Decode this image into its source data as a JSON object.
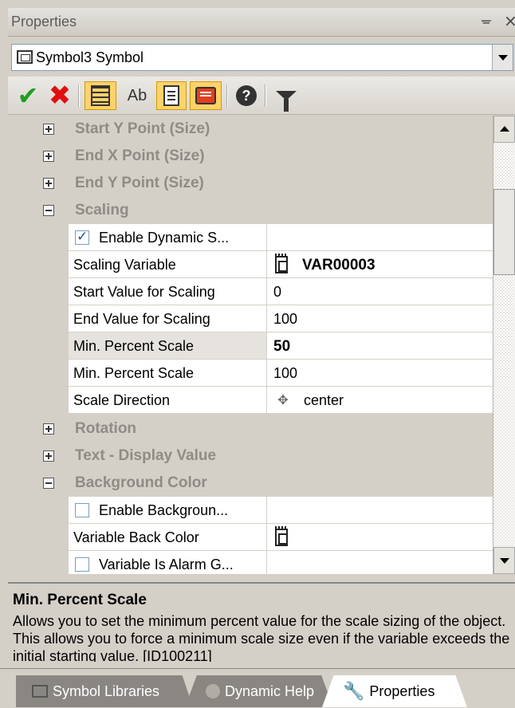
{
  "panel": {
    "title": "Properties",
    "pin_glyph": "ᚚ",
    "close_glyph": "×"
  },
  "selector": {
    "value": "Symbol3 Symbol"
  },
  "toolbar": {
    "icons": [
      "check-icon",
      "cross-icon",
      "categorized-icon",
      "alphabetic-icon",
      "document-icon",
      "comment-icon",
      "help-icon",
      "filter-icon"
    ],
    "check_glyph": "✔",
    "x_glyph": "✖",
    "ab_glyph": "Ab",
    "help_glyph": "?"
  },
  "grid": {
    "categories": {
      "start_y": "Start Y Point (Size)",
      "end_x": "End X Point (Size)",
      "end_y": "End Y Point (Size)",
      "scaling": "Scaling",
      "rotation": "Rotation",
      "text_display": "Text - Display Value",
      "background_color": "Background Color"
    },
    "scaling_props": {
      "enable_dynamic": {
        "label": "Enable Dynamic S...",
        "checked": true
      },
      "scaling_variable": {
        "name": "Scaling Variable",
        "value": "VAR00003"
      },
      "start_value": {
        "name": "Start Value for Scaling",
        "value": "0"
      },
      "end_value": {
        "name": "End Value for Scaling",
        "value": "100"
      },
      "min_percent": {
        "name": "Min. Percent Scale",
        "value": "50"
      },
      "min_percent_2": {
        "name": "Min. Percent Scale",
        "value": "100"
      },
      "scale_direction": {
        "name": "Scale Direction",
        "value": "center",
        "icon_glyph": "✥"
      }
    },
    "background_props": {
      "enable_background": {
        "label": "Enable Backgroun...",
        "checked": false
      },
      "variable_back_color": {
        "name": "Variable Back Color",
        "value": ""
      },
      "variable_is_alarm": {
        "label": "Variable Is Alarm G...",
        "checked": false
      }
    }
  },
  "description": {
    "title": "Min. Percent Scale",
    "text": "Allows you to set the minimum percent value for the scale sizing of the object. This allows you to force a minimum scale size even if the variable exceeds the initial starting value. [ID100211]"
  },
  "tabs": [
    {
      "label": "Symbol Libraries",
      "active": false
    },
    {
      "label": "Dynamic Help",
      "active": false
    },
    {
      "label": "Properties",
      "active": true
    }
  ],
  "colors": {
    "panel_bg": "#d4d0c8",
    "check": "#1e9e1e",
    "cross": "#e01010",
    "toolbar_highlight": "#ffd26a",
    "category_text": "#8f8c86"
  }
}
